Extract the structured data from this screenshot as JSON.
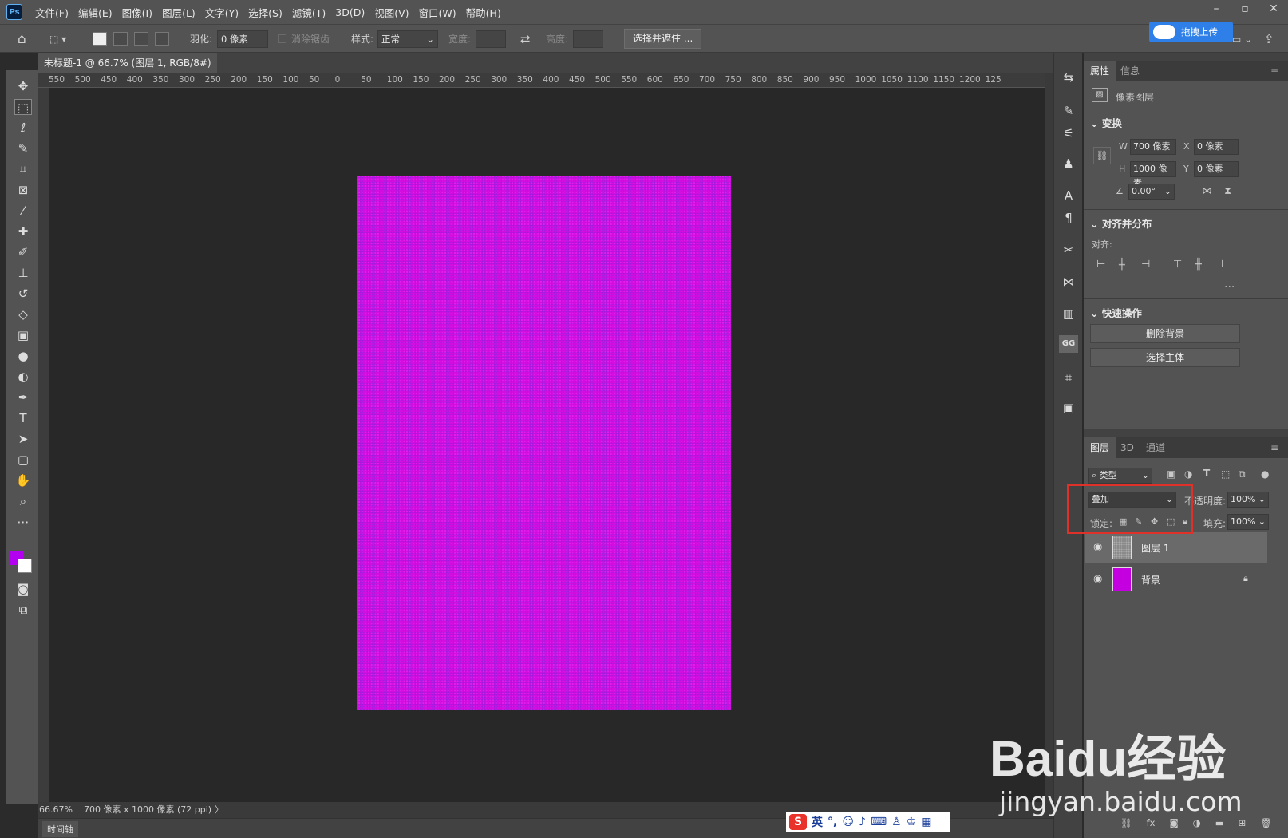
{
  "menubar": {
    "app_icon": "Ps",
    "items": [
      "文件(F)",
      "编辑(E)",
      "图像(I)",
      "图层(L)",
      "文字(Y)",
      "选择(S)",
      "滤镜(T)",
      "3D(D)",
      "视图(V)",
      "窗口(W)",
      "帮助(H)"
    ],
    "window_controls": [
      "–",
      "▫",
      "✕"
    ]
  },
  "options": {
    "feather_label": "羽化:",
    "feather_value": "0 像素",
    "antialias_label": "消除锯齿",
    "style_label": "样式:",
    "style_value": "正常",
    "width_label": "宽度:",
    "height_label": "高度:",
    "select_mask_button": "选择并遮住 ...",
    "upload_button": "拖拽上传"
  },
  "document": {
    "tab_title": "未标题-1 @ 66.7% (图层 1, RGB/8#) *",
    "close": "×",
    "ruler_h_ticks": [
      "550",
      "500",
      "450",
      "400",
      "350",
      "300",
      "250",
      "200",
      "150",
      "100",
      "50",
      "0",
      "50",
      "100",
      "150",
      "200",
      "250",
      "300",
      "350",
      "400",
      "450",
      "500",
      "550",
      "600",
      "650",
      "700",
      "750",
      "800",
      "850",
      "900",
      "950",
      "1000",
      "1050",
      "1100",
      "1150",
      "1200",
      "125"
    ],
    "canvas_fill": "#d40de0"
  },
  "status": {
    "zoom": "66.67%",
    "doc_size": "700 像素 x 1000 像素 (72 ppi)",
    "arrow": "〉"
  },
  "timeline": {
    "label": "时间轴"
  },
  "ime": {
    "lang": "英",
    "logo": "S"
  },
  "properties": {
    "tabs": [
      "属性",
      "信息"
    ],
    "layer_kind": "像素图层",
    "transform": {
      "header": "变换",
      "w_label": "W",
      "w_value": "700 像素",
      "x_label": "X",
      "x_value": "0 像素",
      "h_label": "H",
      "h_value": "1000 像素",
      "y_label": "Y",
      "y_value": "0 像素",
      "angle_value": "0.00°"
    },
    "align": {
      "header": "对齐并分布",
      "label": "对齐:",
      "more": "..."
    },
    "quick": {
      "header": "快速操作",
      "remove_bg": "删除背景",
      "select_subject": "选择主体"
    }
  },
  "layers": {
    "tabs": [
      "图层",
      "3D",
      "通道"
    ],
    "filter_kind": "类型",
    "blend_mode": "叠加",
    "opacity_label": "不透明度:",
    "opacity_value": "100%",
    "lock_label": "锁定:",
    "fill_label": "填充:",
    "fill_value": "100%",
    "items": [
      {
        "name": "图层 1",
        "selected": true
      },
      {
        "name": "背景",
        "locked": true,
        "color": "#c400e0"
      }
    ]
  },
  "watermark": {
    "brand": "Baidu经验",
    "url": "jingyan.baidu.com"
  },
  "colors": {
    "foreground": "#b300f0",
    "background": "#ffffff",
    "highlight_box": "#e0302a"
  }
}
